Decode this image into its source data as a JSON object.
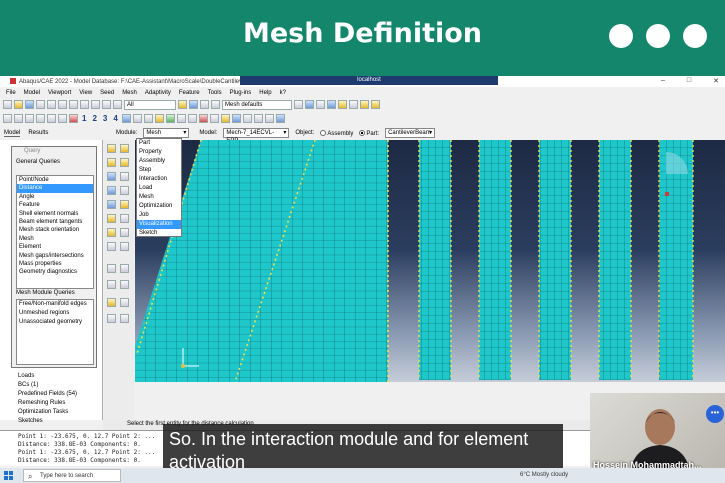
{
  "banner": {
    "title": "Mesh Definition"
  },
  "window": {
    "title": "Abaqus/CAE 2022 - Model Database: F:\\CAE-Assistant\\MacroScale\\DoubleCantileverBea",
    "overlay": "localhost",
    "controls": [
      "–",
      "□",
      "✕"
    ]
  },
  "menu": [
    "File",
    "Model",
    "Viewport",
    "View",
    "Seed",
    "Mesh",
    "Adaptivity",
    "Feature",
    "Tools",
    "Plug-ins",
    "Help",
    "k?"
  ],
  "toolbar": {
    "all_filter": "All",
    "mesh_defaults": "Mesh defaults",
    "numbers": [
      "1",
      "2",
      "3",
      "4"
    ]
  },
  "context": {
    "tabs": [
      "Model",
      "Results"
    ],
    "module_label": "Module:",
    "module_value": "Mesh",
    "model_label": "Model:",
    "model_value": "Mech-7_14ECVL-EPP",
    "object_label": "Object:",
    "object_assembly": "Assembly",
    "object_part": "Part:",
    "part_value": "CantileverBeam"
  },
  "module_menu": [
    "Part",
    "Property",
    "Assembly",
    "Step",
    "Interaction",
    "Load",
    "Mesh",
    "Optimization",
    "Job",
    "Visualization",
    "Sketch"
  ],
  "module_menu_selected": 9,
  "query": {
    "title": "Query",
    "general_label": "General Queries",
    "general": [
      "Point/Node",
      "Distance",
      "Angle",
      "Feature",
      "Shell element normals",
      "Beam element tangents",
      "Mesh stack orientation",
      "Mesh",
      "Element",
      "Mesh gaps/intersections",
      "Mass properties",
      "Geometry diagnostics"
    ],
    "general_selected": 1,
    "mesh_label": "Mesh Module Queries",
    "mesh": [
      "Free/Non-manifold edges",
      "Unmeshed regions",
      "Unassociated geometry"
    ]
  },
  "tree": [
    "Loads",
    "BCs (1)",
    "Predefined Fields (54)",
    "Remeshing Rules",
    "Optimization Tasks",
    "Sketches"
  ],
  "prompt": "Select the first entity for the distance calculation",
  "messages": [
    "Point 1: -23.675, 0.  12.7  Point 2: ...",
    "   Distance: 338.8E-03  Components: 0.",
    "Point 1: -23.675, 0.  12.7  Point 2: ...",
    "   Distance: 338.8E-03  Components: 0."
  ],
  "caption": "So. In the interaction module and for element activation",
  "webcam": {
    "name": "Hossein Mohammadtah..."
  },
  "taskbar": {
    "search": "Type here to search",
    "weather": "6°C  Mostly cloudy"
  },
  "colors": {
    "banner": "#14866c",
    "mesh": "#19c2c2",
    "selection": "#3399ff"
  }
}
